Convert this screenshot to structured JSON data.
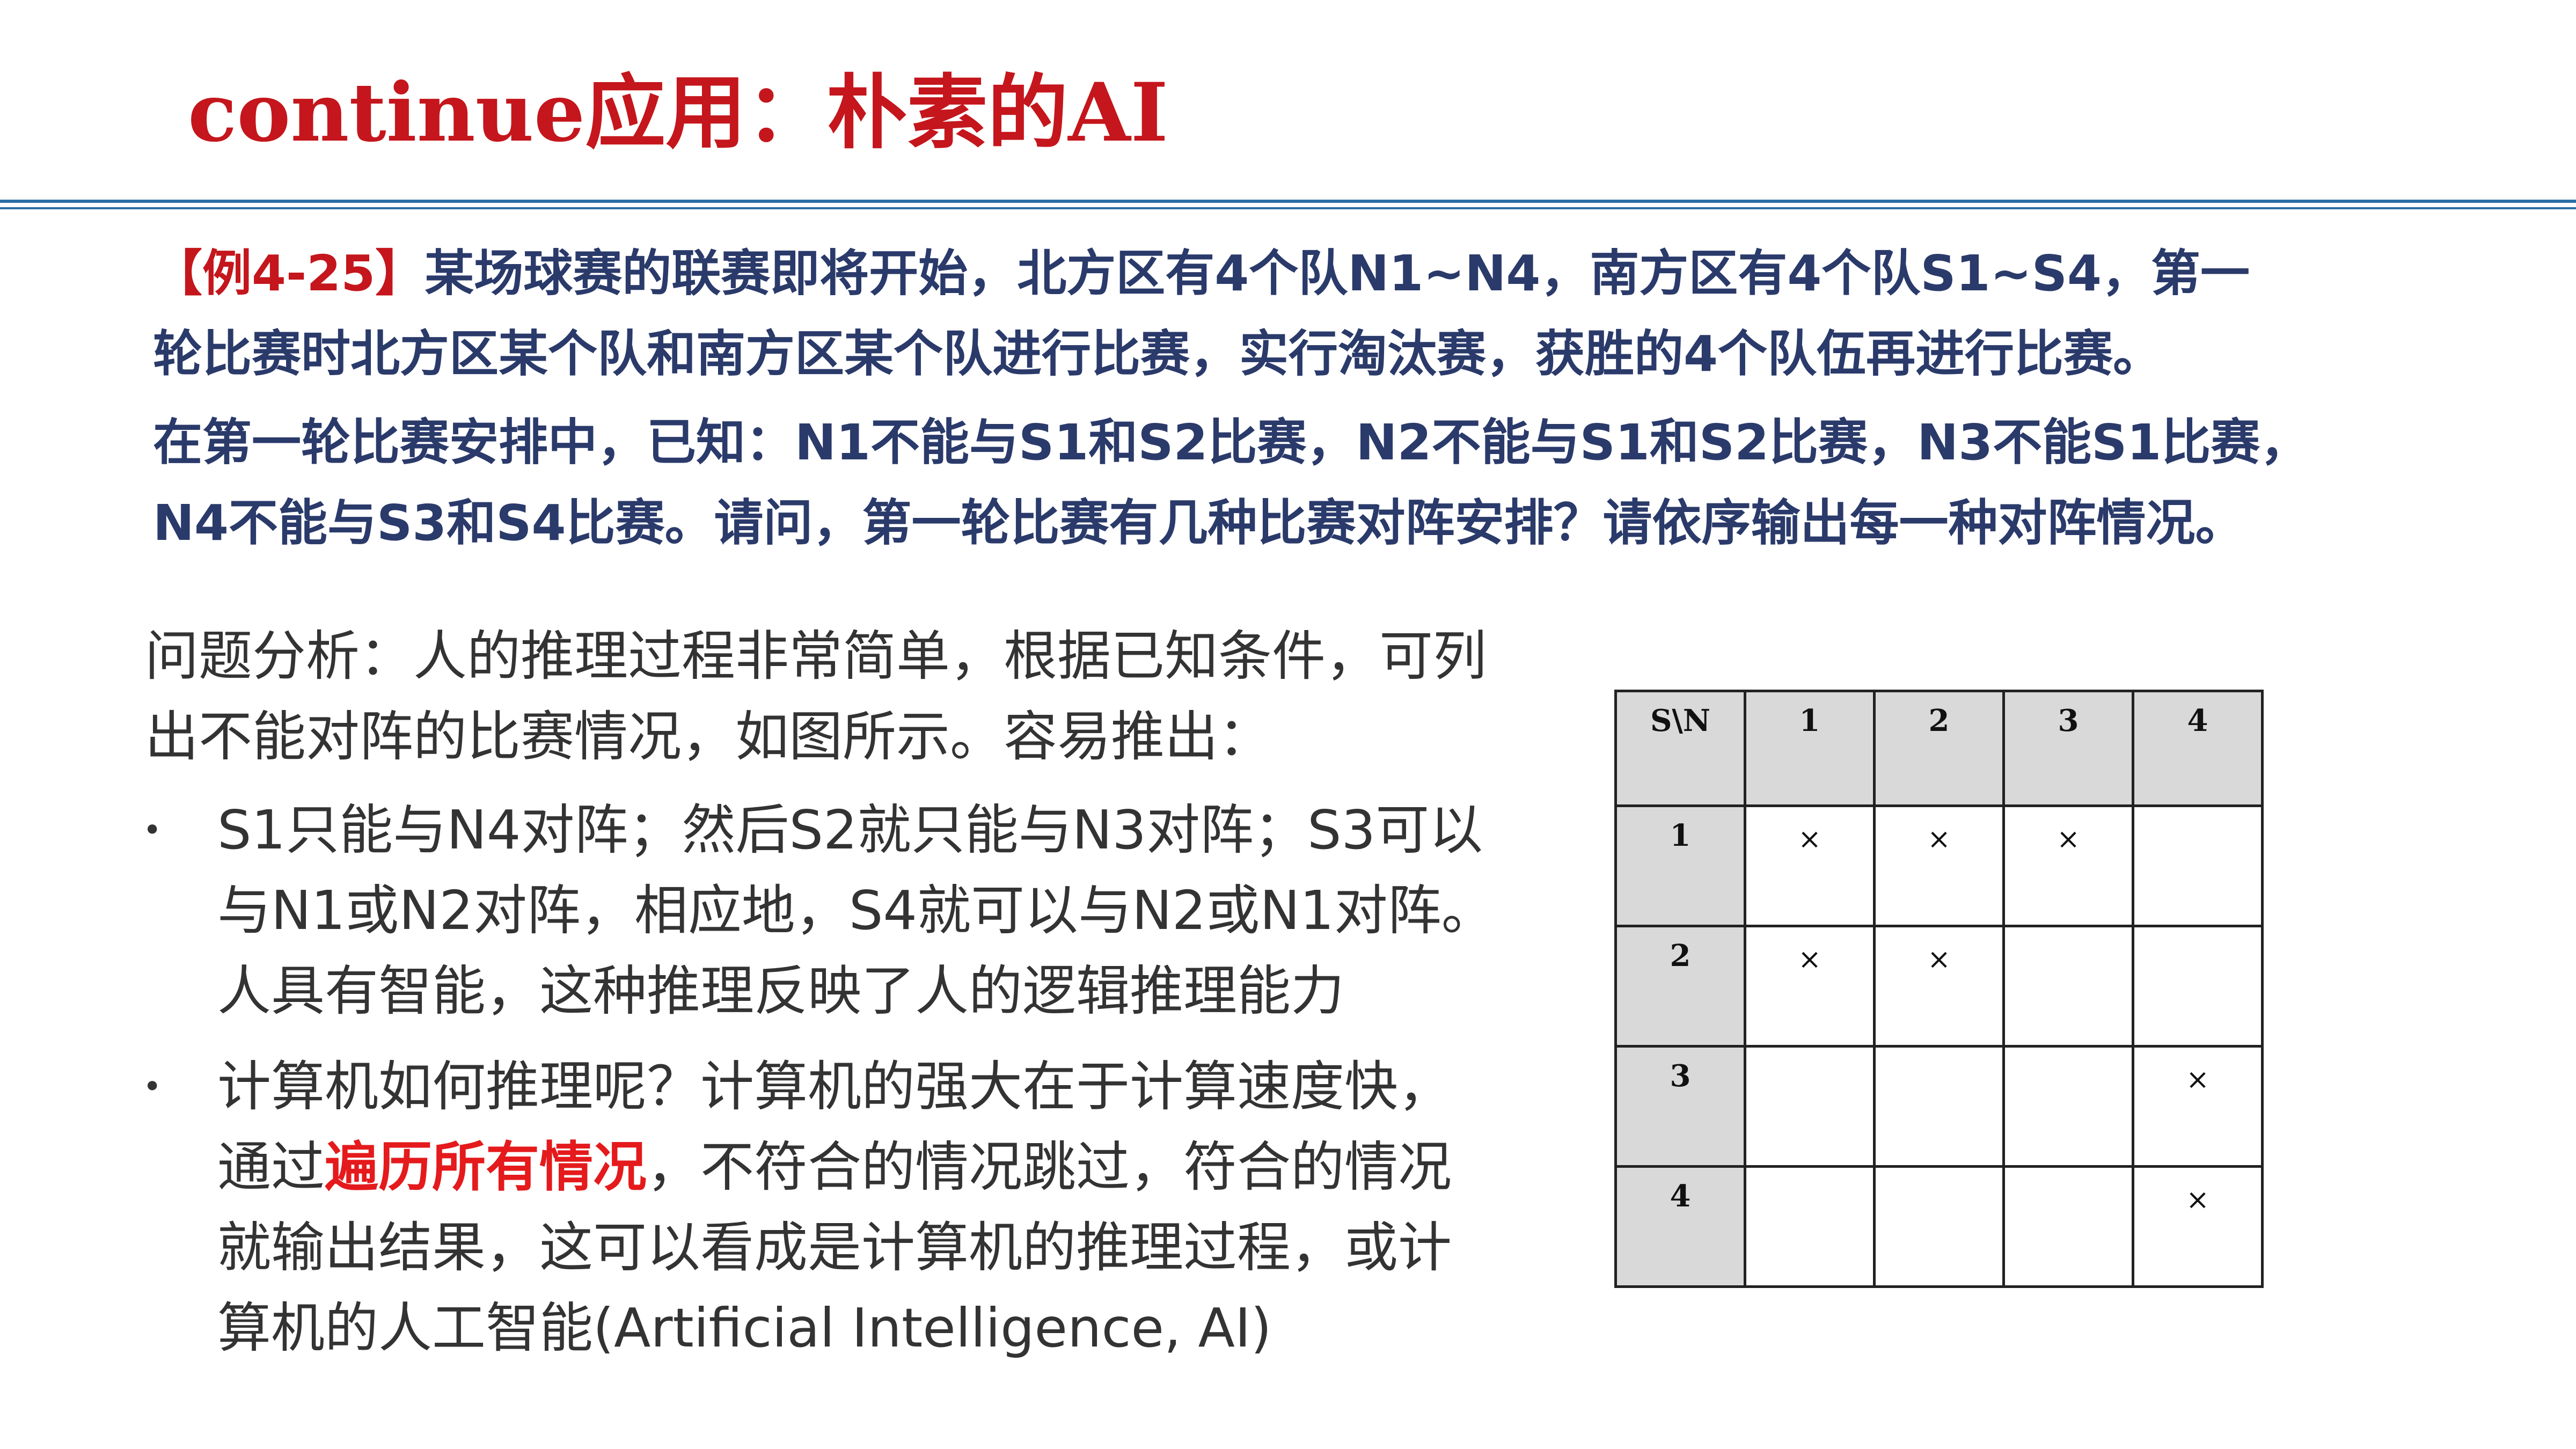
{
  "slide_title": "continue应用：朴素的AI",
  "example": {
    "tag": "【例4-25】",
    "line1": "某场球赛的联赛即将开始，北方区有4个队N1~N4，南方区有4个队S1~S4，第一",
    "line2": "轮比赛时北方区某个队和南方区某个队进行比赛，实行淘汰赛，获胜的4个队伍再进行比赛。",
    "line3": "在第一轮比赛安排中，已知：N1不能与S1和S2比赛，N2不能与S1和S2比赛，N3不能S1比赛，",
    "line4": "N4不能与S3和S4比赛。请问，第一轮比赛有几种比赛对阵安排？请依序输出每一种对阵情况。"
  },
  "analysis": {
    "line1": "问题分析：人的推理过程非常简单，根据已知条件，可列",
    "line2": "出不能对阵的比赛情况，如图所示。容易推出："
  },
  "bullets": [
    {
      "marker": "•",
      "lines": [
        "S1只能与N4对阵；然后S2就只能与N3对阵；S3可以",
        "与N1或N2对阵，相应地，S4就可以与N2或N1对阵。",
        "人具有智能，这种推理反映了人的逻辑推理能力"
      ]
    },
    {
      "marker": "•",
      "line1": "计算机如何推理呢？计算机的强大在于计算速度快，",
      "line2_prefix": "通过",
      "line2_highlight": "遍历所有情况",
      "line2_suffix": "，不符合的情况跳过，符合的情况",
      "line3": "就输出结果，这可以看成是计算机的推理过程，或计",
      "line4": "算机的人工智能(Artificial Intelligence, AI)"
    }
  ],
  "table": {
    "corner": "S\\N",
    "col_headers": [
      "1",
      "2",
      "3",
      "4"
    ],
    "rows": [
      {
        "header": "1",
        "cells": [
          "×",
          "×",
          "×",
          ""
        ]
      },
      {
        "header": "2",
        "cells": [
          "×",
          "×",
          "",
          ""
        ]
      },
      {
        "header": "3",
        "cells": [
          "",
          "",
          "",
          "×"
        ]
      },
      {
        "header": "4",
        "cells": [
          "",
          "",
          "",
          "×"
        ]
      }
    ]
  },
  "colors": {
    "title_red": "#c4161c",
    "rule_blue": "#2d6fa6",
    "example_navy": "#2a3a6a",
    "highlight_red": "#e41a1c",
    "header_gray": "#d9d9d9"
  }
}
